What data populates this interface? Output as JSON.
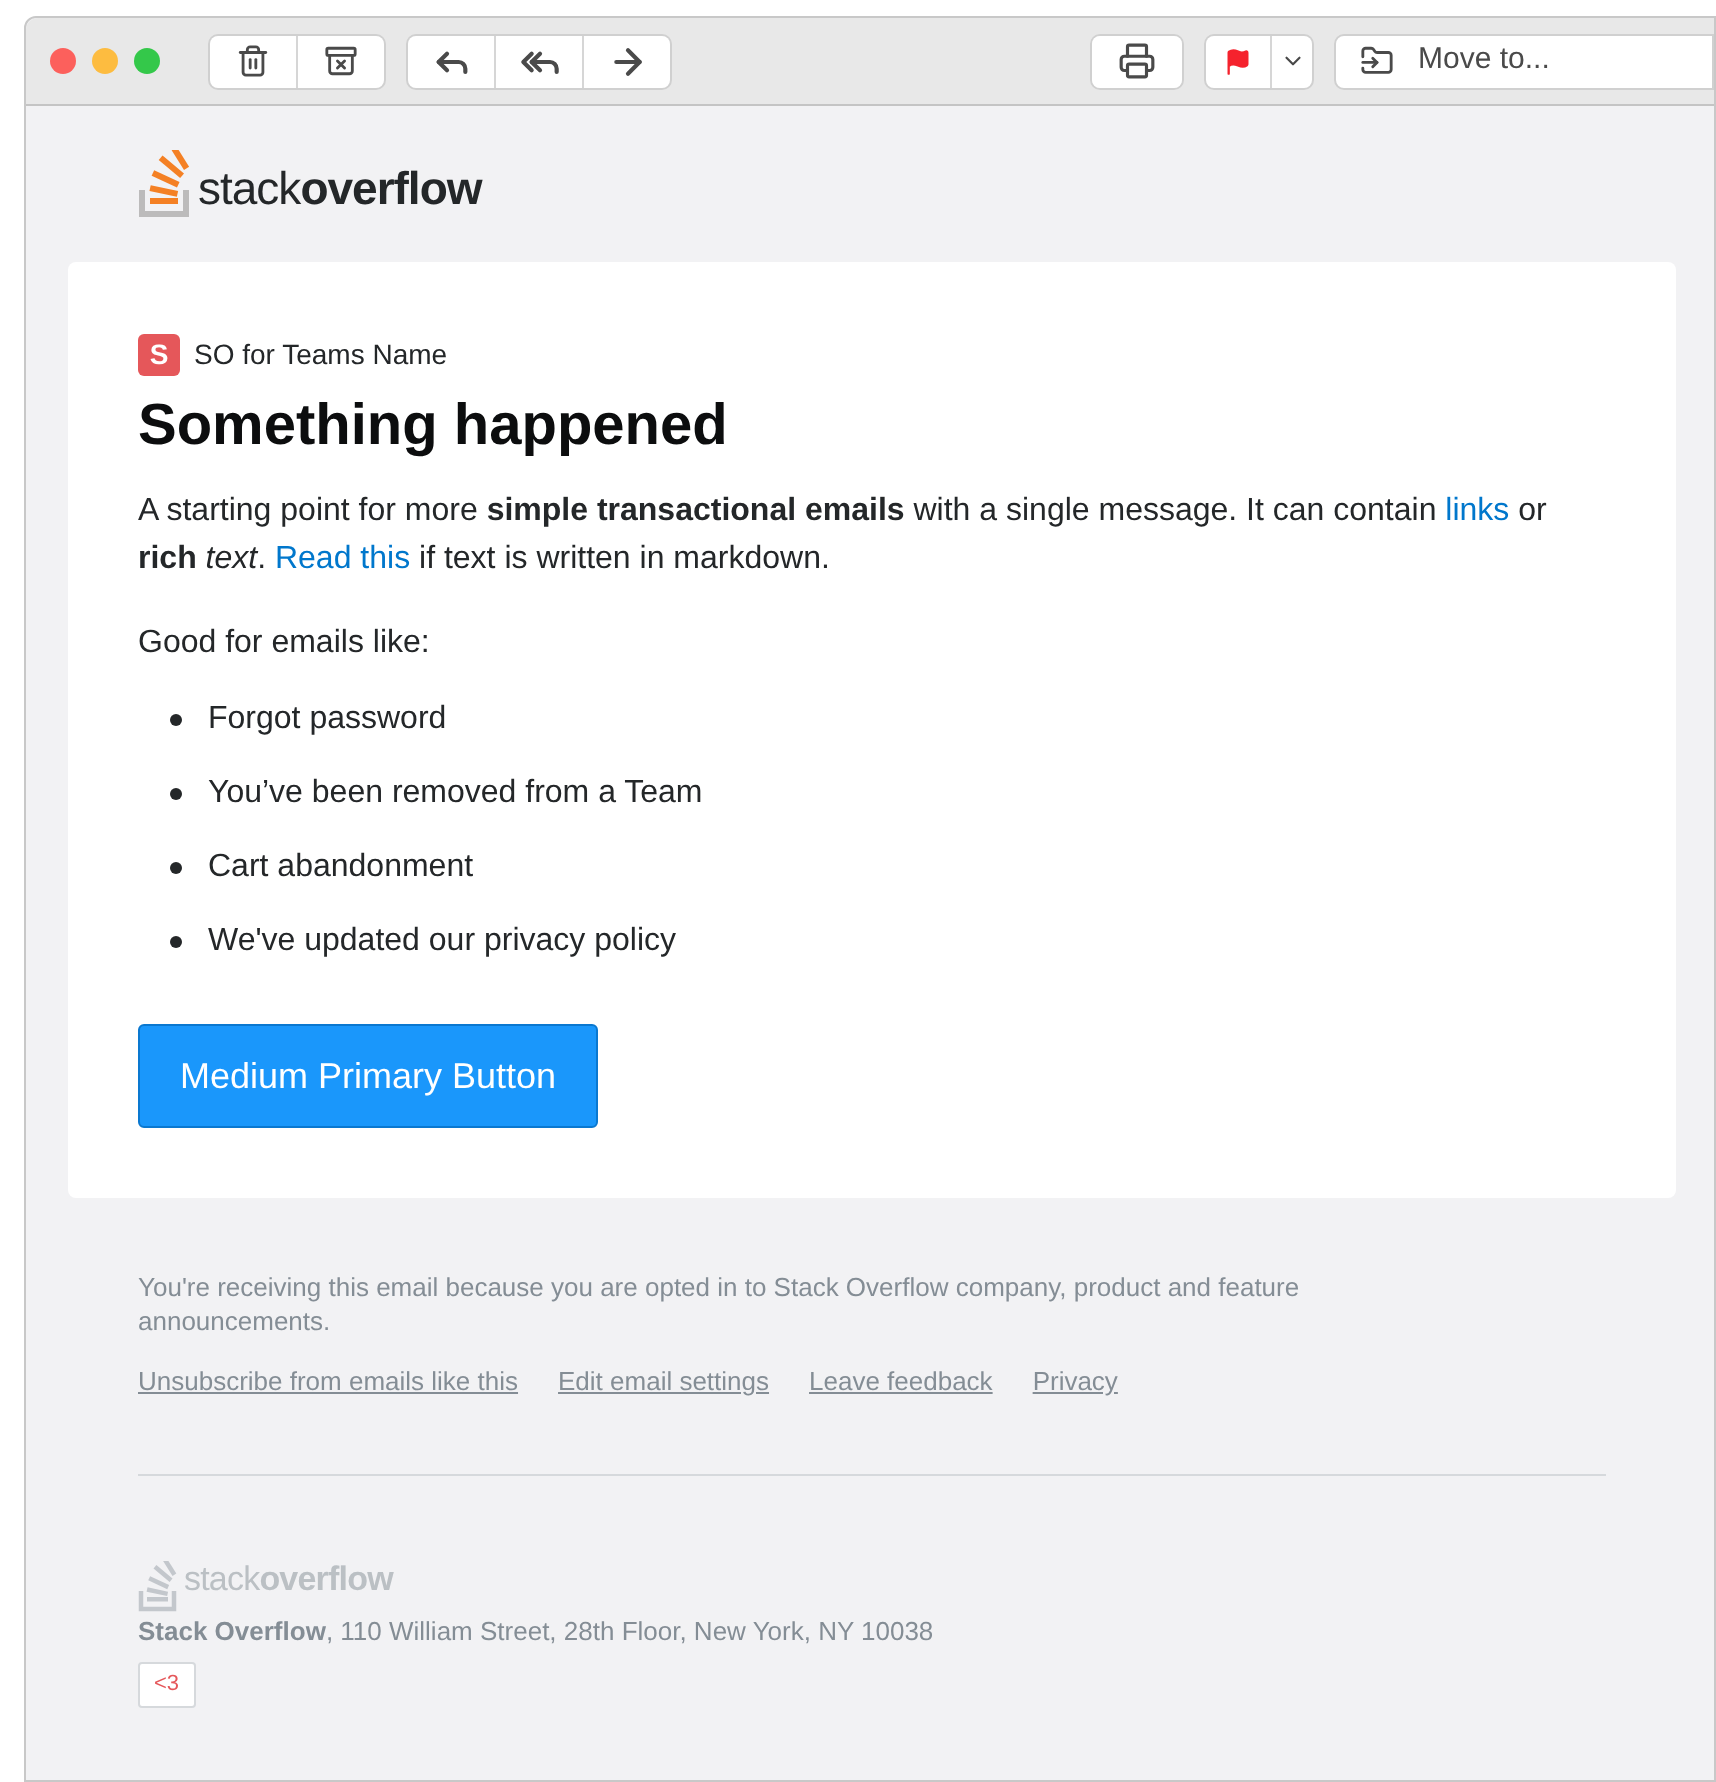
{
  "toolbar": {
    "move_to": "Move to...",
    "flagged": true
  },
  "logo": "stack**overflow**",
  "card": {
    "team_badge": "S",
    "team_name": "SO for Teams Name",
    "title": "Something happened",
    "paragraph": [
      {
        "kind": "plain",
        "text": "A starting point for more "
      },
      {
        "kind": "bold",
        "text": "simple transactional emails"
      },
      {
        "kind": "plain",
        "text": " with a single message. It can contain "
      },
      {
        "kind": "link",
        "text": "links"
      },
      {
        "kind": "plain",
        "text": " or "
      },
      {
        "kind": "bold",
        "text": "rich"
      },
      {
        "kind": "italic",
        "text": " text"
      },
      {
        "kind": "plain",
        "text": ". "
      },
      {
        "kind": "link",
        "text": "Read this"
      },
      {
        "kind": "plain",
        "text": " if text is written in markdown."
      }
    ],
    "intro": "Good for emails like:",
    "bullets": [
      "Forgot password",
      "You’ve been removed from a Team",
      "Cart abandonment",
      "We've updated our privacy policy"
    ],
    "button": "Medium Primary Button"
  },
  "footer": {
    "notice": "You're receiving this email because you are opted in to Stack Overflow company, product and feature announcements.",
    "links": [
      "Unsubscribe from emails like this",
      "Edit email settings",
      "Leave feedback",
      "Privacy"
    ],
    "logo": "stack**overflow**",
    "address": "**Stack Overflow**, 110 William Street, 28th Floor, New York, NY 10038",
    "heart": "<3"
  }
}
